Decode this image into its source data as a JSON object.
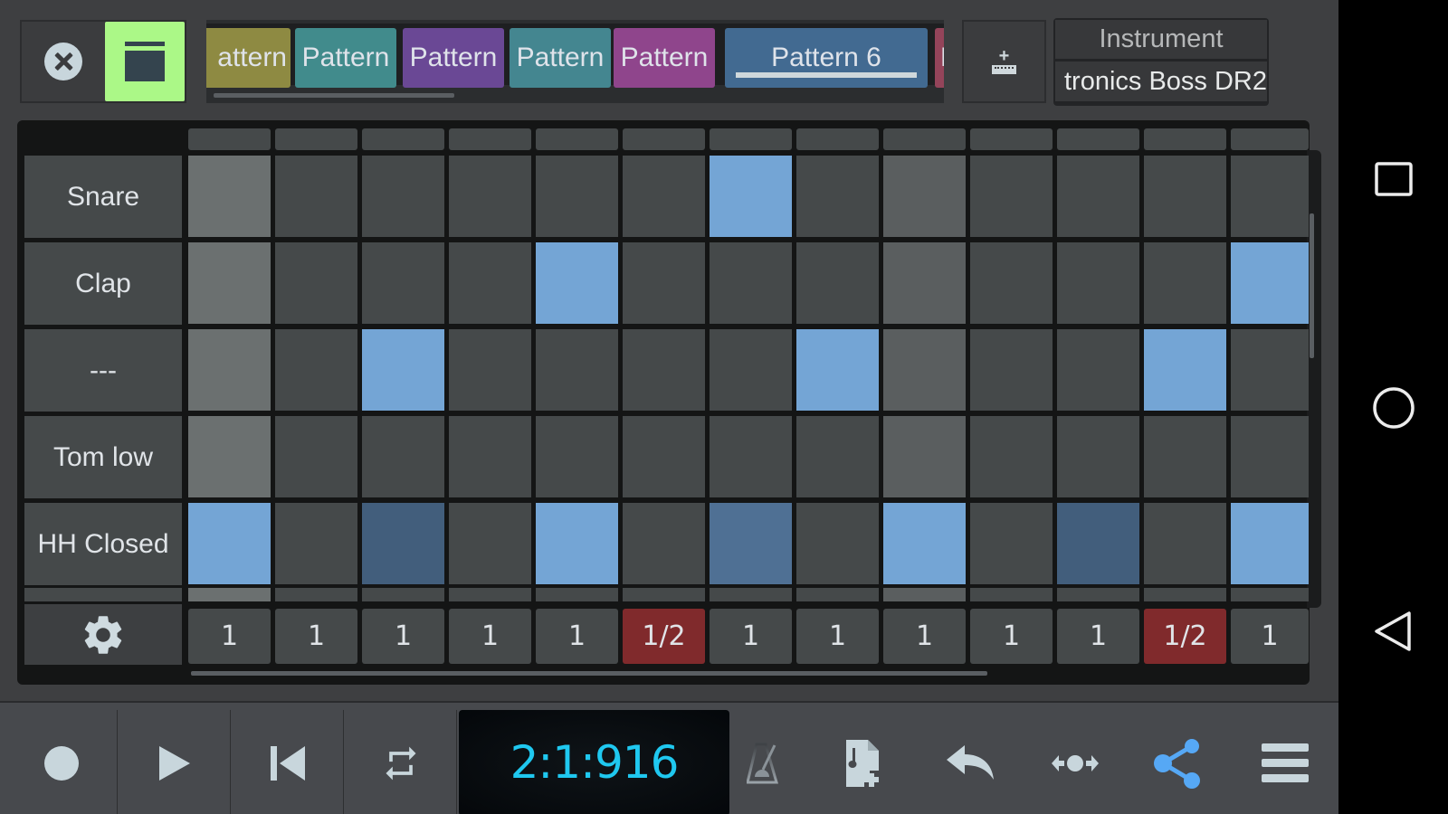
{
  "topbar": {
    "close_icon": "close-circle-icon",
    "window_icon": "window-icon",
    "tabs": [
      {
        "label": "attern",
        "color": "#8e8a42",
        "selected": false
      },
      {
        "label": "Pattern",
        "color": "#418b8c",
        "selected": false
      },
      {
        "label": "Pattern",
        "color": "#6a4895",
        "selected": false
      },
      {
        "label": "Pattern",
        "color": "#448690",
        "selected": false
      },
      {
        "label": "Pattern",
        "color": "#8f458c",
        "selected": false
      },
      {
        "label": "Pattern 6",
        "color": "#426a91",
        "selected": true
      },
      {
        "label": "P",
        "color": "#94445a",
        "selected": false
      }
    ],
    "add_instrument_icon": "add-keyboard-icon",
    "instrument_title": "Instrument",
    "instrument_name": "tronics Boss DR2"
  },
  "grid": {
    "steps": 13,
    "rows": [
      {
        "label": "Snare",
        "cells": [
          0,
          0,
          0,
          0,
          0,
          0,
          1,
          0,
          0,
          0,
          0,
          0,
          0
        ]
      },
      {
        "label": "Clap",
        "cells": [
          0,
          0,
          0,
          0,
          1,
          0,
          0,
          0,
          0,
          0,
          0,
          0,
          1
        ]
      },
      {
        "label": "---",
        "cells": [
          0,
          0,
          1,
          0,
          0,
          0,
          0,
          1,
          0,
          0,
          0,
          1,
          0
        ]
      },
      {
        "label": "Tom low",
        "cells": [
          0,
          0,
          0,
          0,
          0,
          0,
          0,
          0,
          0,
          0,
          0,
          0,
          0
        ]
      },
      {
        "label": "HH Closed",
        "cells": [
          1,
          0,
          0.4,
          0,
          1,
          0,
          0.6,
          0,
          1,
          0,
          0.4,
          0,
          1
        ]
      }
    ],
    "highlight_columns": {
      "playhead": 0,
      "beat": 8
    },
    "step_lengths": [
      "1",
      "1",
      "1",
      "1",
      "1",
      "1/2",
      "1",
      "1",
      "1",
      "1",
      "1",
      "1/2",
      "1"
    ],
    "settings_icon": "gear-icon"
  },
  "colors": {
    "cell_off": "#45494a",
    "cell_playhead": "#6b7070",
    "cell_beat": "#5a5e5f",
    "cell_on": "#74a5d5",
    "cell_on_med": "#4f7094",
    "cell_on_low": "#425e7c",
    "step_half": "#802a2c",
    "accent": "#1fc8f0",
    "share": "#56a8f5"
  },
  "toolbar": {
    "record_icon": "record-icon",
    "play_icon": "play-icon",
    "rewind_icon": "skip-to-start-icon",
    "loop_icon": "loop-icon",
    "time": "2:1:916",
    "metronome_icon": "metronome-icon",
    "new_file_icon": "add-music-file-icon",
    "undo_icon": "undo-icon",
    "move_icon": "move-horizontal-icon",
    "share_icon": "share-icon",
    "menu_icon": "menu-icon"
  },
  "navbar": {
    "recents_icon": "recents-square-icon",
    "home_icon": "home-circle-icon",
    "back_icon": "back-triangle-icon"
  }
}
